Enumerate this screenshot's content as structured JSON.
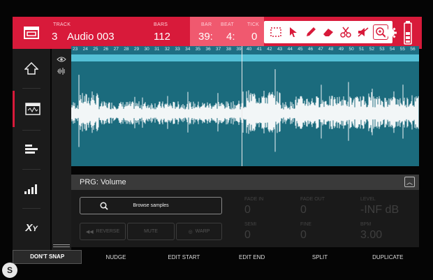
{
  "header": {
    "track_label": "TRACK",
    "track_number": "3",
    "track_name": "Audio 003",
    "bars_label": "BARS",
    "bars_value": "112",
    "bar_label": "BAR",
    "bar_value": "39:",
    "beat_label": "BEAT",
    "beat_value": "4:",
    "tick_label": "TICK",
    "tick_value": "0"
  },
  "tools": [
    {
      "name": "select-icon"
    },
    {
      "name": "pointer-icon"
    },
    {
      "name": "pencil-icon"
    },
    {
      "name": "eraser-icon"
    },
    {
      "name": "scissors-icon"
    },
    {
      "name": "mute-icon"
    },
    {
      "name": "zoom-icon",
      "active": true
    }
  ],
  "ruler": {
    "marks": [
      "23",
      "24",
      "25",
      "26",
      "27",
      "28",
      "29",
      "30",
      "31",
      "32",
      "33",
      "34",
      "35",
      "36",
      "37",
      "38",
      "39",
      "40",
      "41",
      "42",
      "43",
      "44",
      "45",
      "46",
      "47",
      "48",
      "49",
      "50",
      "51",
      "52",
      "53",
      "54",
      "55",
      "56"
    ]
  },
  "sidebar": {
    "items": [
      "home-icon",
      "waveform-edit-icon",
      "track-view-icon",
      "level-icon",
      "xy-icon"
    ]
  },
  "panel": {
    "prg_title": "PRG: Volume",
    "browse_label": "Browse samples",
    "reverse_label": "REVERSE",
    "mute_label": "MUTE",
    "warp_label": "WARP",
    "params": [
      {
        "label": "FADE IN",
        "value": "0"
      },
      {
        "label": "FADE OUT",
        "value": "0"
      },
      {
        "label": "LEVEL",
        "value": "-INF dB"
      },
      {
        "label": "SEMI",
        "value": "0"
      },
      {
        "label": "FINE",
        "value": "0"
      },
      {
        "label": "BPM",
        "value": "3.00"
      }
    ]
  },
  "bottom_bar": [
    "DON'T SNAP",
    "NUDGE",
    "EDIT START",
    "EDIT END",
    "SPLIT",
    "DUPLICATE"
  ],
  "colors": {
    "accent": "#d81a3a",
    "waveform_bg": "#1b6b7d",
    "loop": "#54c0d6"
  }
}
